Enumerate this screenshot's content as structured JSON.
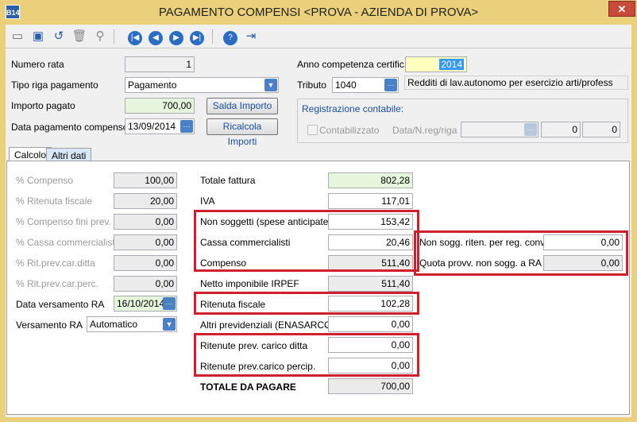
{
  "window": {
    "title": "PAGAMENTO COMPENSI <PROVA - AZIENDA DI PROVA>",
    "app_icon_text": "B14",
    "close_label": "✕"
  },
  "header": {
    "numero_rata": {
      "label": "Numero rata",
      "value": "1"
    },
    "tipo_riga": {
      "label": "Tipo riga pagamento",
      "value": "Pagamento"
    },
    "importo_pagato": {
      "label": "Importo pagato",
      "value": "700,00"
    },
    "data_pagamento": {
      "label": "Data pagamento compenso",
      "value": "13/09/2014"
    },
    "saldo_button": "Salda Importo",
    "ricalcola_button": "Ricalcola Importi",
    "anno_competenza": {
      "label": "Anno competenza certific.",
      "value": "2014"
    },
    "tributo": {
      "label": "Tributo",
      "code": "1040",
      "description": "Redditi di lav.autonomo per esercizio arti/profess"
    },
    "registrazione": {
      "title": "Registrazione contabile:",
      "contabilizzato": "Contabilizzato",
      "data_label": "Data/N.reg/riga",
      "n_reg": "0",
      "riga": "0"
    }
  },
  "tabs": [
    {
      "label": "Calcolo"
    },
    {
      "label": "Altri dati"
    }
  ],
  "left": {
    "perc_compenso": {
      "label": "% Compenso",
      "value": "100,00"
    },
    "perc_ritenuta": {
      "label": "% Ritenuta fiscale",
      "value": "20,00"
    },
    "perc_comp_prev": {
      "label": "% Compenso fini prev.",
      "value": "0,00"
    },
    "perc_cassa": {
      "label": "% Cassa commercialisti",
      "value": "0,00"
    },
    "perc_rit_ditta": {
      "label": "% Rit.prev.car.ditta",
      "value": "0,00"
    },
    "perc_rit_perc": {
      "label": "% Rit.prev.car.perc.",
      "value": "0,00"
    },
    "data_versamento": {
      "label": "Data versamento RA",
      "value": "16/10/2014"
    },
    "versamento": {
      "label": "Versamento RA",
      "value": "Automatico"
    }
  },
  "middle": {
    "totale_fattura": {
      "label": "Totale fattura",
      "value": "802,28"
    },
    "iva": {
      "label": "IVA",
      "value": "117,01"
    },
    "non_soggetti": {
      "label": "Non soggetti (spese anticipate)",
      "value": "153,42"
    },
    "cassa": {
      "label": "Cassa commercialisti",
      "value": "20,46"
    },
    "compenso": {
      "label": "Compenso",
      "value": "511,40"
    },
    "netto": {
      "label": "Netto imponibile IRPEF",
      "value": "511,40"
    },
    "ritenuta": {
      "label": "Ritenuta fiscale",
      "value": "102,28"
    },
    "altri_prev": {
      "label": "Altri previdenziali (ENASARCO)",
      "value": "0,00"
    },
    "rit_ditta": {
      "label": "Ritenute prev. carico ditta",
      "value": "0,00"
    },
    "rit_percip": {
      "label": "Ritenute prev.carico percip.",
      "value": "0,00"
    },
    "totale": {
      "label": "TOTALE DA PAGARE",
      "value": "700,00"
    }
  },
  "right": {
    "non_sogg_riten": {
      "label": "Non sogg. riten. per reg. conv.",
      "value": "0,00"
    },
    "quota_provv": {
      "label": "Quota provv. non sogg. a RA",
      "value": "0,00"
    }
  },
  "icons": [
    "new-icon",
    "save-icon",
    "undo-icon",
    "delete-icon",
    "search-icon",
    "first-icon",
    "prev-icon",
    "next-icon",
    "last-icon",
    "help-icon",
    "exit-icon"
  ],
  "colors": {
    "title_bar": "#ead07a",
    "highlight_box": "#d02030",
    "green_field": "#e6f6dc",
    "yellow_field": "#ffffc0"
  }
}
